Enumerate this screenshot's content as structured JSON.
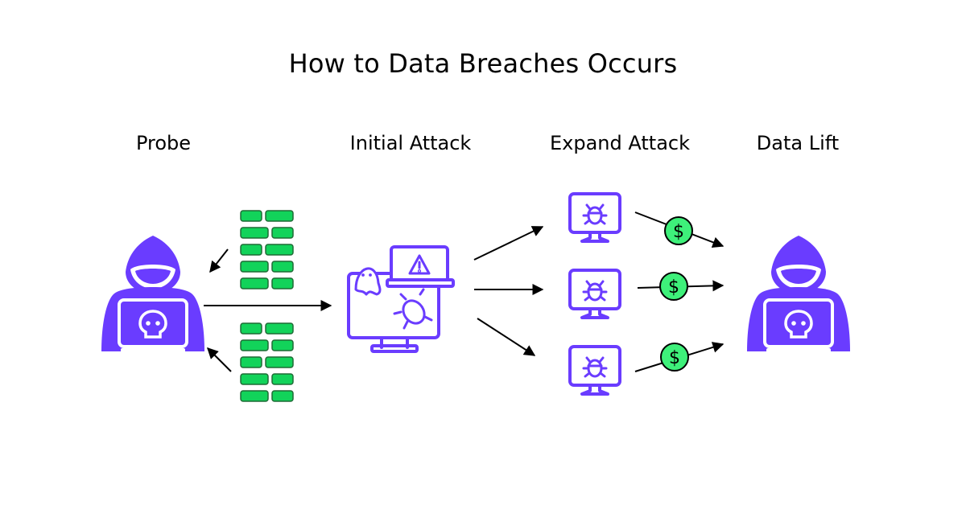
{
  "title": "How to Data Breaches Occurs",
  "stages": [
    {
      "label": "Probe"
    },
    {
      "label": "Initial Attack"
    },
    {
      "label": "Expand Attack"
    },
    {
      "label": "Data Lift"
    }
  ],
  "colors": {
    "purple": "#6a3cff",
    "brick_green": "#12d35a",
    "coin_green": "#3ef07a",
    "arrow": "#000000"
  },
  "icons": {
    "probe": "hacker-icon",
    "walls": "firewall-icon",
    "initial_attack": "infected-computer-icon",
    "expand_targets": "bug-monitor-icon",
    "data_lift": "hacker-icon",
    "money": "dollar-coin-icon"
  },
  "coin_symbol": "$"
}
